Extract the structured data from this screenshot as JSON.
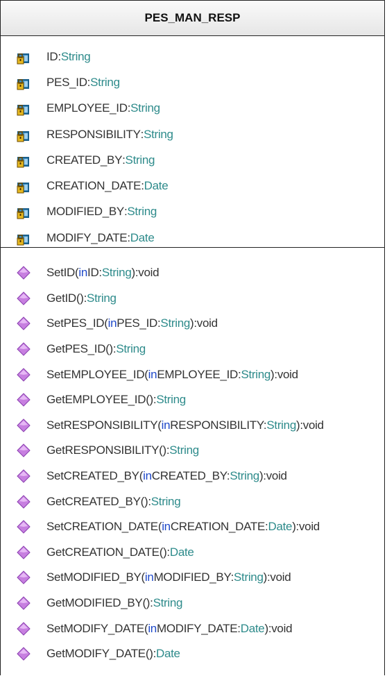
{
  "class_name": "PES_MAN_RESP",
  "colors": {
    "keyword": "#1f49c9",
    "type": "#2e8b8b",
    "text": "#333333",
    "method_icon": "#c77fe0",
    "field_icon": "#1a5f8c"
  },
  "attributes": [
    {
      "name": "ID",
      "sep": ":",
      "type": "String",
      "icon": "private-field-icon"
    },
    {
      "name": "PES_ID",
      "sep": ":",
      "type": "String",
      "icon": "private-field-icon"
    },
    {
      "name": "EMPLOYEE_ID",
      "sep": ":",
      "type": "String",
      "icon": "private-field-icon"
    },
    {
      "name": "RESPONSIBILITY",
      "sep": ":",
      "type": "String",
      "icon": "private-field-icon"
    },
    {
      "name": "CREATED_BY",
      "sep": ":",
      "type": "String",
      "icon": "private-field-icon"
    },
    {
      "name": "CREATION_DATE",
      "sep": ":",
      "type": "Date",
      "icon": "private-field-icon"
    },
    {
      "name": "MODIFIED_BY",
      "sep": ":",
      "type": "String",
      "icon": "private-field-icon"
    },
    {
      "name": "MODIFY_DATE",
      "sep": ":",
      "type": "Date",
      "icon": "private-field-icon"
    }
  ],
  "operations": [
    {
      "parts": [
        [
          "t",
          "SetID("
        ],
        [
          "k",
          "in"
        ],
        [
          "t",
          " ID:"
        ],
        [
          "y",
          "String"
        ],
        [
          "t",
          "):void"
        ]
      ]
    },
    {
      "parts": [
        [
          "t",
          "GetID():"
        ],
        [
          "y",
          "String"
        ]
      ]
    },
    {
      "parts": [
        [
          "t",
          "SetPES_ID("
        ],
        [
          "k",
          "in"
        ],
        [
          "t",
          " PES_ID:"
        ],
        [
          "y",
          "String"
        ],
        [
          "t",
          "):void"
        ]
      ]
    },
    {
      "parts": [
        [
          "t",
          "GetPES_ID():"
        ],
        [
          "y",
          "String"
        ]
      ]
    },
    {
      "parts": [
        [
          "t",
          "SetEMPLOYEE_ID("
        ],
        [
          "k",
          "in"
        ],
        [
          "t",
          " EMPLOYEE_ID:"
        ],
        [
          "y",
          "String"
        ],
        [
          "t",
          "):void"
        ]
      ]
    },
    {
      "parts": [
        [
          "t",
          "GetEMPLOYEE_ID():"
        ],
        [
          "y",
          "String"
        ]
      ]
    },
    {
      "parts": [
        [
          "t",
          "SetRESPONSIBILITY("
        ],
        [
          "k",
          "in"
        ],
        [
          "t",
          " RESPONSIBILITY:"
        ],
        [
          "y",
          "String"
        ],
        [
          "t",
          "):void"
        ]
      ]
    },
    {
      "parts": [
        [
          "t",
          "GetRESPONSIBILITY():"
        ],
        [
          "y",
          "String"
        ]
      ]
    },
    {
      "parts": [
        [
          "t",
          "SetCREATED_BY("
        ],
        [
          "k",
          "in"
        ],
        [
          "t",
          " CREATED_BY:"
        ],
        [
          "y",
          "String"
        ],
        [
          "t",
          "):void"
        ]
      ]
    },
    {
      "parts": [
        [
          "t",
          "GetCREATED_BY():"
        ],
        [
          "y",
          "String"
        ]
      ]
    },
    {
      "parts": [
        [
          "t",
          "SetCREATION_DATE("
        ],
        [
          "k",
          "in"
        ],
        [
          "t",
          " CREATION_DATE:"
        ],
        [
          "y",
          "Date"
        ],
        [
          "t",
          "):void"
        ]
      ]
    },
    {
      "parts": [
        [
          "t",
          "GetCREATION_DATE():"
        ],
        [
          "y",
          "Date"
        ]
      ]
    },
    {
      "parts": [
        [
          "t",
          "SetMODIFIED_BY("
        ],
        [
          "k",
          "in"
        ],
        [
          "t",
          " MODIFIED_BY:"
        ],
        [
          "y",
          "String"
        ],
        [
          "t",
          "):void"
        ]
      ]
    },
    {
      "parts": [
        [
          "t",
          "GetMODIFIED_BY():"
        ],
        [
          "y",
          "String"
        ]
      ]
    },
    {
      "parts": [
        [
          "t",
          "SetMODIFY_DATE("
        ],
        [
          "k",
          "in"
        ],
        [
          "t",
          " MODIFY_DATE:"
        ],
        [
          "y",
          "Date"
        ],
        [
          "t",
          "):void"
        ]
      ]
    },
    {
      "parts": [
        [
          "t",
          "GetMODIFY_DATE():"
        ],
        [
          "y",
          "Date"
        ]
      ]
    }
  ]
}
